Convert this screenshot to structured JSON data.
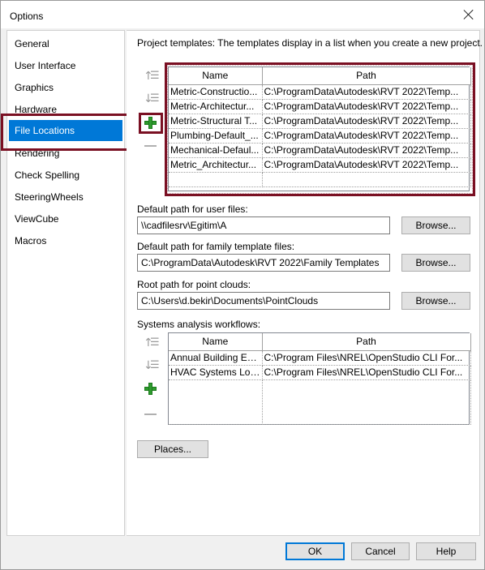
{
  "window": {
    "title": "Options"
  },
  "nav": {
    "items": [
      {
        "label": "General"
      },
      {
        "label": "User Interface"
      },
      {
        "label": "Graphics"
      },
      {
        "label": "Hardware"
      },
      {
        "label": "File Locations"
      },
      {
        "label": "Rendering"
      },
      {
        "label": "Check Spelling"
      },
      {
        "label": "SteeringWheels"
      },
      {
        "label": "ViewCube"
      },
      {
        "label": "Macros"
      }
    ],
    "selected": "File Locations"
  },
  "project_templates": {
    "label": "Project templates:  The templates display in a list when you create a new project.",
    "columns": [
      "Name",
      "Path"
    ],
    "rows": [
      {
        "name": "Metric-Constructio...",
        "path": "C:\\ProgramData\\Autodesk\\RVT 2022\\Temp..."
      },
      {
        "name": "Metric-Architectur...",
        "path": "C:\\ProgramData\\Autodesk\\RVT 2022\\Temp..."
      },
      {
        "name": "Metric-Structural T...",
        "path": "C:\\ProgramData\\Autodesk\\RVT 2022\\Temp..."
      },
      {
        "name": "Plumbing-Default_...",
        "path": "C:\\ProgramData\\Autodesk\\RVT 2022\\Temp..."
      },
      {
        "name": "Mechanical-Defaul...",
        "path": "C:\\ProgramData\\Autodesk\\RVT 2022\\Temp..."
      },
      {
        "name": "Metric_Architectur...",
        "path": "C:\\ProgramData\\Autodesk\\RVT 2022\\Temp..."
      }
    ]
  },
  "user_files": {
    "label": "Default path for user files:",
    "value": "\\\\cadfilesrv\\Egitim\\A",
    "browse": "Browse..."
  },
  "family_templates": {
    "label": "Default path for family template files:",
    "value": "C:\\ProgramData\\Autodesk\\RVT 2022\\Family Templates",
    "browse": "Browse..."
  },
  "point_clouds": {
    "label": "Root path for point clouds:",
    "value": "C:\\Users\\d.bekir\\Documents\\PointClouds",
    "browse": "Browse..."
  },
  "systems_analysis": {
    "label": "Systems analysis workflows:",
    "columns": [
      "Name",
      "Path"
    ],
    "rows": [
      {
        "name": "Annual Building En...",
        "path": "C:\\Program Files\\NREL\\OpenStudio CLI For..."
      },
      {
        "name": "HVAC Systems Loa...",
        "path": "C:\\Program Files\\NREL\\OpenStudio CLI For..."
      }
    ]
  },
  "places_button": "Places...",
  "footer": {
    "ok": "OK",
    "cancel": "Cancel",
    "help": "Help"
  },
  "colors": {
    "accent": "#0078d7",
    "highlight_box": "#7a1023",
    "add_green": "#2e9b2e"
  }
}
